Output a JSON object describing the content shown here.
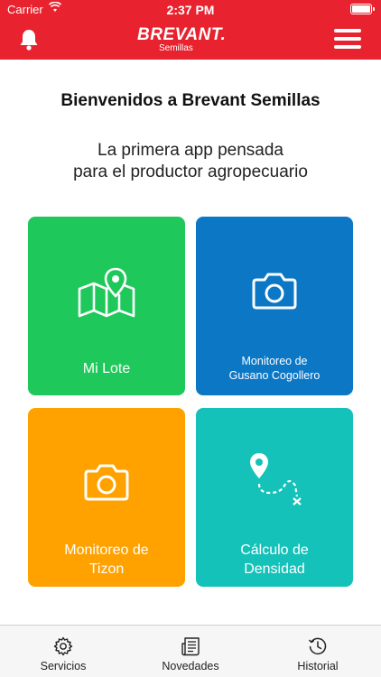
{
  "status_bar": {
    "carrier": "Carrier",
    "time": "2:37 PM"
  },
  "header": {
    "brand": "BREVANT.",
    "subbrand": "Semillas",
    "accent_color": "#e8232f"
  },
  "welcome_title": "Bienvenidos a Brevant Semillas",
  "tagline": {
    "line1": "La primera app pensada",
    "line2": "para el productor agropecuario"
  },
  "tiles": [
    {
      "lines": [
        "Mi Lote"
      ],
      "icon": "map-pin-icon",
      "color": "#1fc85a"
    },
    {
      "lines": [
        "Monitoreo de",
        "Gusano Cogollero"
      ],
      "icon": "camera-icon",
      "color": "#0b77c5"
    },
    {
      "lines": [
        "Monitoreo de",
        "Tizon"
      ],
      "icon": "camera-icon",
      "color": "#ffa200"
    },
    {
      "lines": [
        "Cálculo de",
        "Densidad"
      ],
      "icon": "route-icon",
      "color": "#14c2b9"
    }
  ],
  "tabbar": [
    {
      "label": "Servicios",
      "icon": "gear-icon"
    },
    {
      "label": "Novedades",
      "icon": "news-icon"
    },
    {
      "label": "Historial",
      "icon": "history-icon"
    }
  ]
}
